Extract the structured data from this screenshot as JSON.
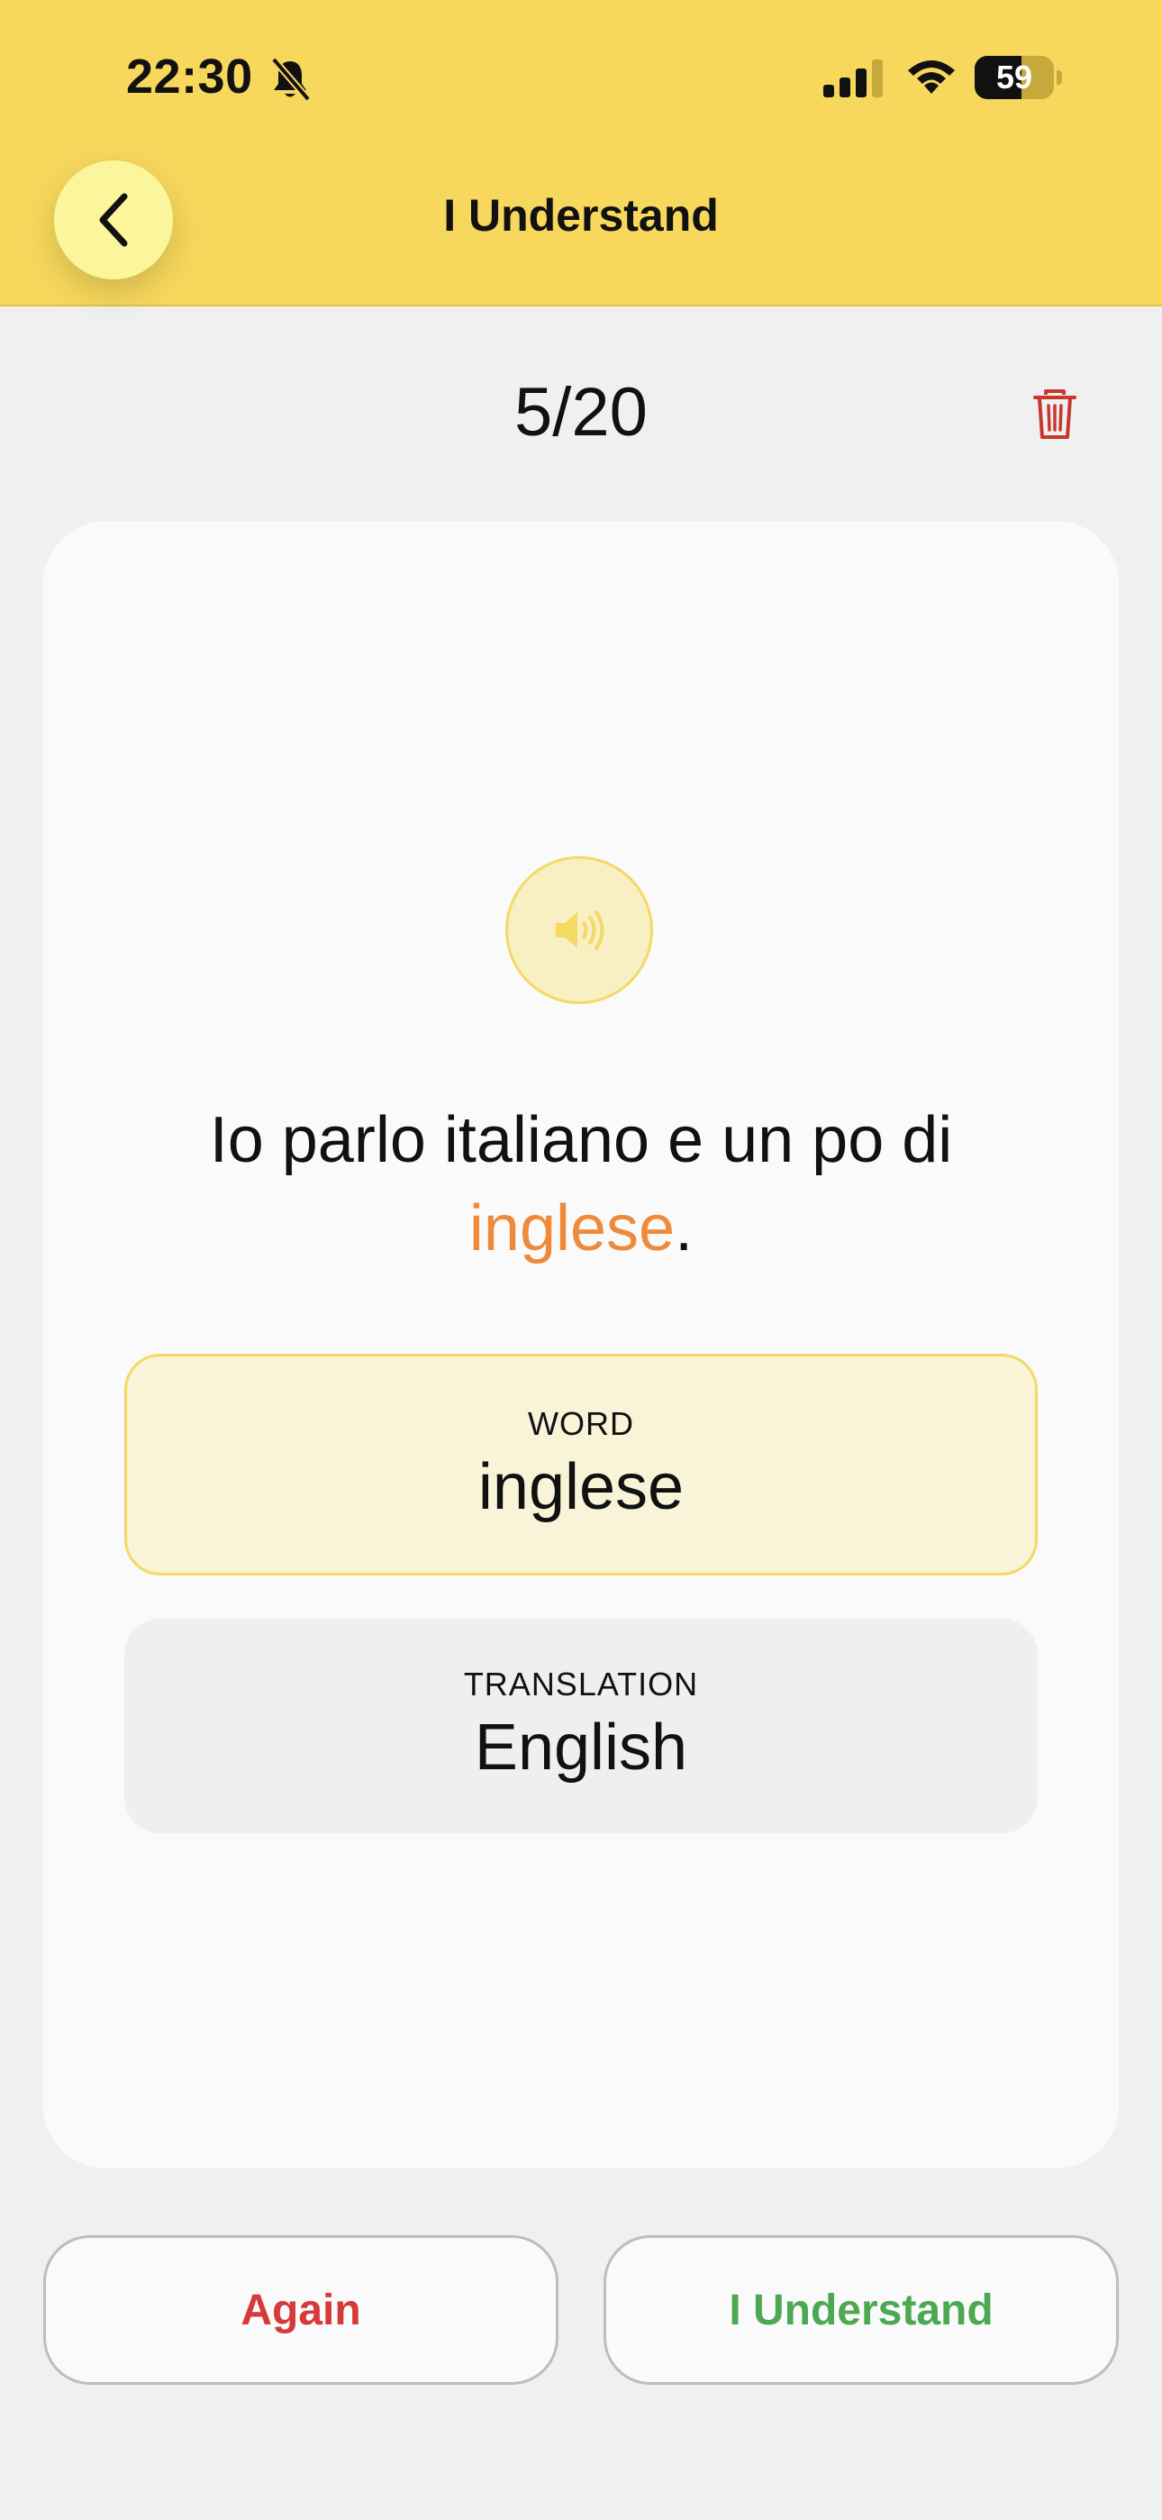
{
  "status_bar": {
    "time": "22:30",
    "battery": "59",
    "battery_level": 0.59
  },
  "header": {
    "title": "I Understand"
  },
  "progress": {
    "text": "5/20"
  },
  "card": {
    "sentence_before": "Io parlo italiano e un po di ",
    "sentence_highlight": "inglese",
    "sentence_after": ".",
    "word_label": "WORD",
    "word_value": "inglese",
    "translation_label": "TRANSLATION",
    "translation_value": "English"
  },
  "actions": {
    "again_label": "Again",
    "understand_label": "I Understand"
  },
  "colors": {
    "header_bg": "#f7d75c",
    "highlight": "#ee8a3c",
    "again": "#d53a3a",
    "understand": "#4ca852",
    "trash": "#c8372d"
  },
  "icons": {
    "back": "chevron-left-icon",
    "trash": "trash-icon",
    "audio": "speaker-icon",
    "silent": "bell-slash-icon",
    "signal": "signal-icon",
    "wifi": "wifi-icon",
    "battery": "battery-icon"
  }
}
